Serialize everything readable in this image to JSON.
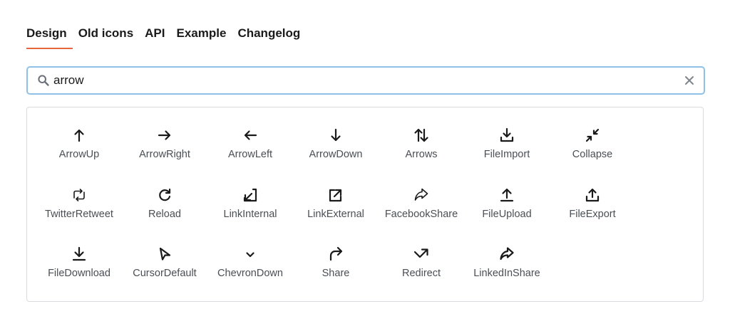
{
  "tabs": [
    {
      "label": "Design",
      "active": true
    },
    {
      "label": "Old icons",
      "active": false
    },
    {
      "label": "API",
      "active": false
    },
    {
      "label": "Example",
      "active": false
    },
    {
      "label": "Changelog",
      "active": false
    }
  ],
  "search": {
    "value": "arrow",
    "icon": "search-icon",
    "clear_icon": "close-icon"
  },
  "accent_color": "#e8663b",
  "focus_border_color": "#8fc0e6",
  "icons": [
    {
      "label": "ArrowUp",
      "icon": "arrow-up-icon"
    },
    {
      "label": "ArrowRight",
      "icon": "arrow-right-icon"
    },
    {
      "label": "ArrowLeft",
      "icon": "arrow-left-icon"
    },
    {
      "label": "ArrowDown",
      "icon": "arrow-down-icon"
    },
    {
      "label": "Arrows",
      "icon": "arrows-icon"
    },
    {
      "label": "FileImport",
      "icon": "file-import-icon"
    },
    {
      "label": "Collapse",
      "icon": "collapse-icon"
    },
    {
      "label": "TwitterRetweet",
      "icon": "twitter-retweet-icon"
    },
    {
      "label": "Reload",
      "icon": "reload-icon"
    },
    {
      "label": "LinkInternal",
      "icon": "link-internal-icon"
    },
    {
      "label": "LinkExternal",
      "icon": "link-external-icon"
    },
    {
      "label": "FacebookShare",
      "icon": "facebook-share-icon"
    },
    {
      "label": "FileUpload",
      "icon": "file-upload-icon"
    },
    {
      "label": "FileExport",
      "icon": "file-export-icon"
    },
    {
      "label": "FileDownload",
      "icon": "file-download-icon"
    },
    {
      "label": "CursorDefault",
      "icon": "cursor-default-icon"
    },
    {
      "label": "ChevronDown",
      "icon": "chevron-down-icon"
    },
    {
      "label": "Share",
      "icon": "share-icon"
    },
    {
      "label": "Redirect",
      "icon": "redirect-icon"
    },
    {
      "label": "LinkedInShare",
      "icon": "linkedin-share-icon"
    }
  ]
}
